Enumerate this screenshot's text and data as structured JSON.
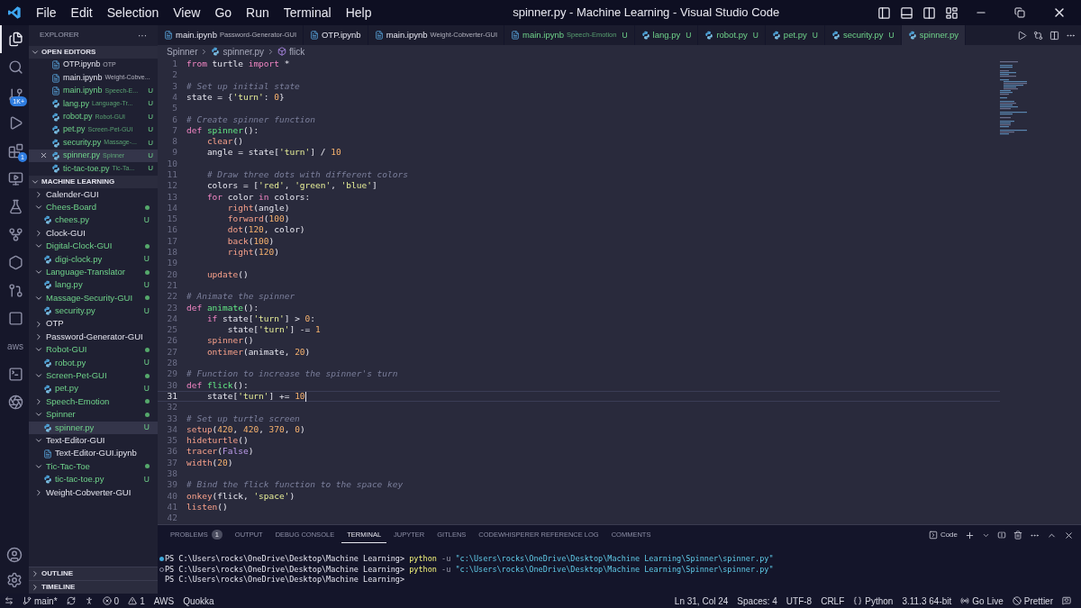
{
  "title_bar": {
    "menu": [
      "File",
      "Edit",
      "Selection",
      "View",
      "Go",
      "Run",
      "Terminal",
      "Help"
    ],
    "title": "spinner.py - Machine Learning - Visual Studio Code"
  },
  "activity_bar": {
    "items": [
      {
        "kind": "files",
        "selected": true
      },
      {
        "kind": "search",
        "selected": false
      },
      {
        "kind": "source-control",
        "selected": false,
        "badge": "1K+"
      },
      {
        "kind": "run",
        "selected": false
      },
      {
        "kind": "extensions",
        "selected": false,
        "badge": "1"
      },
      {
        "kind": "remote",
        "selected": false
      },
      {
        "kind": "testing",
        "selected": false
      },
      {
        "kind": "git-graph",
        "selected": false
      },
      {
        "kind": "hexagon",
        "selected": false
      },
      {
        "kind": "git-branch",
        "selected": false
      },
      {
        "kind": "square",
        "selected": false
      },
      {
        "kind": "aws",
        "selected": false,
        "label": "aws"
      },
      {
        "kind": "terminal",
        "selected": false
      },
      {
        "kind": "knot",
        "selected": false
      }
    ]
  },
  "sidebar": {
    "title": "EXPLORER",
    "more": "···",
    "open_editors": {
      "title": "OPEN EDITORS",
      "expanded": true,
      "items": [
        {
          "kind": "notebook",
          "name": "OTP.ipynb",
          "desc": "OTP",
          "untracked": false,
          "selected": false
        },
        {
          "kind": "notebook",
          "name": "main.ipynb",
          "desc": "Weight-Cobve...",
          "untracked": false,
          "selected": false
        },
        {
          "kind": "notebook",
          "name": "main.ipynb",
          "desc": "Speech-E...",
          "untracked": true,
          "badge": "U",
          "selected": false
        },
        {
          "kind": "python",
          "name": "lang.py",
          "desc": "Language-Tr...",
          "untracked": true,
          "badge": "U",
          "selected": false
        },
        {
          "kind": "python",
          "name": "robot.py",
          "desc": "Robot-GUI",
          "untracked": true,
          "badge": "U",
          "selected": false
        },
        {
          "kind": "python",
          "name": "pet.py",
          "desc": "Screen-Pet-GUI",
          "untracked": true,
          "badge": "U",
          "selected": false
        },
        {
          "kind": "python",
          "name": "security.py",
          "desc": "Massage-...",
          "untracked": true,
          "badge": "U",
          "selected": false
        },
        {
          "kind": "python",
          "name": "spinner.py",
          "desc": "Spinner",
          "untracked": true,
          "badge": "U",
          "selected": true
        },
        {
          "kind": "python",
          "name": "tic-tac-toe.py",
          "desc": "Tic-Ta...",
          "untracked": true,
          "badge": "U",
          "selected": false
        }
      ]
    },
    "folder": {
      "title": "MACHINE LEARNING",
      "expanded": true,
      "tree": [
        {
          "kind": "folder",
          "name": "Calender-GUI",
          "expanded": false,
          "untracked": false,
          "selected": false
        },
        {
          "kind": "folder",
          "name": "Chees-Board",
          "expanded": true,
          "untracked": true,
          "selected": false,
          "children": [
            {
              "kind": "python",
              "name": "chees.py",
              "untracked": true,
              "badge": "U",
              "selected": false
            }
          ]
        },
        {
          "kind": "folder",
          "name": "Clock-GUI",
          "expanded": false,
          "untracked": false,
          "selected": false
        },
        {
          "kind": "folder",
          "name": "Digital-Clock-GUI",
          "expanded": true,
          "untracked": true,
          "selected": false,
          "children": [
            {
              "kind": "python",
              "name": "digi-clock.py",
              "untracked": true,
              "badge": "U",
              "selected": false
            }
          ]
        },
        {
          "kind": "folder",
          "name": "Language-Translator",
          "expanded": true,
          "untracked": true,
          "selected": false,
          "children": [
            {
              "kind": "python",
              "name": "lang.py",
              "untracked": true,
              "badge": "U",
              "selected": false
            }
          ]
        },
        {
          "kind": "folder",
          "name": "Massage-Security-GUI",
          "expanded": true,
          "untracked": true,
          "selected": false,
          "children": [
            {
              "kind": "python",
              "name": "security.py",
              "untracked": true,
              "badge": "U",
              "selected": false
            }
          ]
        },
        {
          "kind": "folder",
          "name": "OTP",
          "expanded": false,
          "untracked": false,
          "selected": false
        },
        {
          "kind": "folder",
          "name": "Password-Generator-GUI",
          "expanded": false,
          "untracked": false,
          "selected": false
        },
        {
          "kind": "folder",
          "name": "Robot-GUI",
          "expanded": true,
          "untracked": true,
          "selected": false,
          "children": [
            {
              "kind": "python",
              "name": "robot.py",
              "untracked": true,
              "badge": "U",
              "selected": false
            }
          ]
        },
        {
          "kind": "folder",
          "name": "Screen-Pet-GUI",
          "expanded": true,
          "untracked": true,
          "selected": false,
          "children": [
            {
              "kind": "python",
              "name": "pet.py",
              "untracked": true,
              "badge": "U",
              "selected": false
            }
          ]
        },
        {
          "kind": "folder",
          "name": "Speech-Emotion",
          "expanded": false,
          "untracked": true,
          "selected": false
        },
        {
          "kind": "folder",
          "name": "Spinner",
          "expanded": true,
          "untracked": true,
          "selected": false,
          "children": [
            {
              "kind": "python",
              "name": "spinner.py",
              "untracked": true,
              "badge": "U",
              "selected": true
            }
          ]
        },
        {
          "kind": "folder",
          "name": "Text-Editor-GUI",
          "expanded": true,
          "untracked": false,
          "selected": false,
          "children": [
            {
              "kind": "notebook",
              "name": "Text-Editor-GUI.ipynb",
              "untracked": false,
              "selected": false
            }
          ]
        },
        {
          "kind": "folder",
          "name": "Tic-Tac-Toe",
          "expanded": true,
          "untracked": true,
          "selected": false,
          "children": [
            {
              "kind": "python",
              "name": "tic-tac-toe.py",
              "untracked": true,
              "badge": "U",
              "selected": false
            }
          ]
        },
        {
          "kind": "folder",
          "name": "Weight-Cobverter-GUI",
          "expanded": false,
          "untracked": false,
          "selected": false
        }
      ]
    },
    "sections": [
      {
        "title": "OUTLINE",
        "expanded": false
      },
      {
        "title": "TIMELINE",
        "expanded": false
      }
    ]
  },
  "editor_tabs": [
    {
      "kind": "notebook",
      "name": "main.ipynb",
      "desc": "Password-Generator-GUI",
      "untracked": false,
      "selected": false
    },
    {
      "kind": "notebook",
      "name": "OTP.ipynb",
      "untracked": false,
      "selected": false
    },
    {
      "kind": "notebook",
      "name": "main.ipynb",
      "desc": "Weight-Cobverter-GUI",
      "untracked": false,
      "selected": false
    },
    {
      "kind": "notebook",
      "name": "main.ipynb",
      "desc": "Speech-Emotion",
      "badge": "U",
      "untracked": true,
      "selected": false
    },
    {
      "kind": "python",
      "name": "lang.py",
      "badge": "U",
      "untracked": true,
      "selected": false
    },
    {
      "kind": "python",
      "name": "robot.py",
      "badge": "U",
      "untracked": true,
      "selected": false
    },
    {
      "kind": "python",
      "name": "pet.py",
      "badge": "U",
      "untracked": true,
      "selected": false
    },
    {
      "kind": "python",
      "name": "security.py",
      "badge": "U",
      "untracked": true,
      "selected": false
    },
    {
      "kind": "python",
      "name": "spinner.py",
      "untracked": true,
      "selected": true
    }
  ],
  "breadcrumb": [
    {
      "kind": "folder",
      "label": "Spinner"
    },
    {
      "kind": "python",
      "label": "spinner.py"
    },
    {
      "kind": "symbol",
      "label": "flick"
    }
  ],
  "editor": {
    "lines": [
      {
        "number": "1",
        "current": false,
        "tokens": [
          {
            "kind": "kw",
            "text": "from"
          },
          {
            "kind": "plain",
            "text": " turtle "
          },
          {
            "kind": "kw",
            "text": "import"
          },
          {
            "kind": "plain",
            "text": " *"
          }
        ]
      },
      {
        "number": "2",
        "current": false
      },
      {
        "number": "3",
        "current": false,
        "tokens": [
          {
            "kind": "cm",
            "text": "# Set up initial state"
          }
        ]
      },
      {
        "number": "4",
        "current": false,
        "tokens": [
          {
            "kind": "plain",
            "text": "state = {"
          },
          {
            "kind": "str",
            "text": "'turn'"
          },
          {
            "kind": "plain",
            "text": ": "
          },
          {
            "kind": "num",
            "text": "0"
          },
          {
            "kind": "plain",
            "text": "}"
          }
        ]
      },
      {
        "number": "5",
        "current": false
      },
      {
        "number": "6",
        "current": false,
        "tokens": [
          {
            "kind": "cm",
            "text": "# Create spinner function"
          }
        ]
      },
      {
        "number": "7",
        "current": false,
        "tokens": [
          {
            "kind": "kw",
            "text": "def"
          },
          {
            "kind": "fn",
            "text": " spinner"
          },
          {
            "kind": "plain",
            "text": "():"
          }
        ]
      },
      {
        "number": "8",
        "current": false,
        "tokens": [
          {
            "kind": "call",
            "text": "    clear"
          },
          {
            "kind": "plain",
            "text": "()"
          }
        ]
      },
      {
        "number": "9",
        "current": false,
        "tokens": [
          {
            "kind": "plain",
            "text": "    angle = state["
          },
          {
            "kind": "str",
            "text": "'turn'"
          },
          {
            "kind": "plain",
            "text": "] / "
          },
          {
            "kind": "num",
            "text": "10"
          }
        ]
      },
      {
        "number": "10",
        "current": false
      },
      {
        "number": "11",
        "current": false,
        "tokens": [
          {
            "kind": "cm",
            "text": "    # Draw three dots with different colors"
          }
        ]
      },
      {
        "number": "12",
        "current": false,
        "tokens": [
          {
            "kind": "plain",
            "text": "    colors = ["
          },
          {
            "kind": "str",
            "text": "'red'"
          },
          {
            "kind": "plain",
            "text": ", "
          },
          {
            "kind": "str",
            "text": "'green'"
          },
          {
            "kind": "plain",
            "text": ", "
          },
          {
            "kind": "str",
            "text": "'blue'"
          },
          {
            "kind": "plain",
            "text": "]"
          }
        ]
      },
      {
        "number": "13",
        "current": false,
        "tokens": [
          {
            "kind": "kw",
            "text": "    for"
          },
          {
            "kind": "plain",
            "text": " color "
          },
          {
            "kind": "kw",
            "text": "in"
          },
          {
            "kind": "plain",
            "text": " colors:"
          }
        ]
      },
      {
        "number": "14",
        "current": false,
        "tokens": [
          {
            "kind": "call",
            "text": "        right"
          },
          {
            "kind": "plain",
            "text": "(angle)"
          }
        ]
      },
      {
        "number": "15",
        "current": false,
        "tokens": [
          {
            "kind": "call",
            "text": "        forward"
          },
          {
            "kind": "plain",
            "text": "("
          },
          {
            "kind": "num",
            "text": "100"
          },
          {
            "kind": "plain",
            "text": ")"
          }
        ]
      },
      {
        "number": "16",
        "current": false,
        "tokens": [
          {
            "kind": "call",
            "text": "        dot"
          },
          {
            "kind": "plain",
            "text": "("
          },
          {
            "kind": "num",
            "text": "120"
          },
          {
            "kind": "plain",
            "text": ", color)"
          }
        ]
      },
      {
        "number": "17",
        "current": false,
        "tokens": [
          {
            "kind": "call",
            "text": "        back"
          },
          {
            "kind": "plain",
            "text": "("
          },
          {
            "kind": "num",
            "text": "100"
          },
          {
            "kind": "plain",
            "text": ")"
          }
        ]
      },
      {
        "number": "18",
        "current": false,
        "tokens": [
          {
            "kind": "call",
            "text": "        right"
          },
          {
            "kind": "plain",
            "text": "("
          },
          {
            "kind": "num",
            "text": "120"
          },
          {
            "kind": "plain",
            "text": ")"
          }
        ]
      },
      {
        "number": "19",
        "current": false
      },
      {
        "number": "20",
        "current": false,
        "tokens": [
          {
            "kind": "call",
            "text": "    update"
          },
          {
            "kind": "plain",
            "text": "()"
          }
        ]
      },
      {
        "number": "21",
        "current": false
      },
      {
        "number": "22",
        "current": false,
        "tokens": [
          {
            "kind": "cm",
            "text": "# Animate the spinner"
          }
        ]
      },
      {
        "number": "23",
        "current": false,
        "tokens": [
          {
            "kind": "kw",
            "text": "def"
          },
          {
            "kind": "fn",
            "text": " animate"
          },
          {
            "kind": "plain",
            "text": "():"
          }
        ]
      },
      {
        "number": "24",
        "current": false,
        "tokens": [
          {
            "kind": "kw",
            "text": "    if"
          },
          {
            "kind": "plain",
            "text": " state["
          },
          {
            "kind": "str",
            "text": "'turn'"
          },
          {
            "kind": "plain",
            "text": "] > "
          },
          {
            "kind": "num",
            "text": "0"
          },
          {
            "kind": "plain",
            "text": ":"
          }
        ]
      },
      {
        "number": "25",
        "current": false,
        "tokens": [
          {
            "kind": "plain",
            "text": "        state["
          },
          {
            "kind": "str",
            "text": "'turn'"
          },
          {
            "kind": "plain",
            "text": "] -= "
          },
          {
            "kind": "num",
            "text": "1"
          }
        ]
      },
      {
        "number": "26",
        "current": false,
        "tokens": [
          {
            "kind": "call",
            "text": "    spinner"
          },
          {
            "kind": "plain",
            "text": "()"
          }
        ]
      },
      {
        "number": "27",
        "current": false,
        "tokens": [
          {
            "kind": "call",
            "text": "    ontimer"
          },
          {
            "kind": "plain",
            "text": "(animate, "
          },
          {
            "kind": "num",
            "text": "20"
          },
          {
            "kind": "plain",
            "text": ")"
          }
        ]
      },
      {
        "number": "28",
        "current": false
      },
      {
        "number": "29",
        "current": false,
        "tokens": [
          {
            "kind": "cm",
            "text": "# Function to increase the spinner's turn"
          }
        ]
      },
      {
        "number": "30",
        "current": false,
        "tokens": [
          {
            "kind": "kw",
            "text": "def"
          },
          {
            "kind": "fn",
            "text": " flick"
          },
          {
            "kind": "plain",
            "text": "():"
          }
        ]
      },
      {
        "number": "31",
        "current": true,
        "tokens": [
          {
            "kind": "plain",
            "text": "    state["
          },
          {
            "kind": "str",
            "text": "'turn'"
          },
          {
            "kind": "plain",
            "text": "] += "
          },
          {
            "kind": "num",
            "text": "10"
          }
        ]
      },
      {
        "number": "32",
        "current": false
      },
      {
        "number": "33",
        "current": false,
        "tokens": [
          {
            "kind": "cm",
            "text": "# Set up turtle screen"
          }
        ]
      },
      {
        "number": "34",
        "current": false,
        "tokens": [
          {
            "kind": "call",
            "text": "setup"
          },
          {
            "kind": "plain",
            "text": "("
          },
          {
            "kind": "num",
            "text": "420"
          },
          {
            "kind": "plain",
            "text": ", "
          },
          {
            "kind": "num",
            "text": "420"
          },
          {
            "kind": "plain",
            "text": ", "
          },
          {
            "kind": "num",
            "text": "370"
          },
          {
            "kind": "plain",
            "text": ", "
          },
          {
            "kind": "num",
            "text": "0"
          },
          {
            "kind": "plain",
            "text": ")"
          }
        ]
      },
      {
        "number": "35",
        "current": false,
        "tokens": [
          {
            "kind": "call",
            "text": "hideturtle"
          },
          {
            "kind": "plain",
            "text": "()"
          }
        ]
      },
      {
        "number": "36",
        "current": false,
        "tokens": [
          {
            "kind": "call",
            "text": "tracer"
          },
          {
            "kind": "plain",
            "text": "("
          },
          {
            "kind": "const",
            "text": "False"
          },
          {
            "kind": "plain",
            "text": ")"
          }
        ]
      },
      {
        "number": "37",
        "current": false,
        "tokens": [
          {
            "kind": "call",
            "text": "width"
          },
          {
            "kind": "plain",
            "text": "("
          },
          {
            "kind": "num",
            "text": "20"
          },
          {
            "kind": "plain",
            "text": ")"
          }
        ]
      },
      {
        "number": "38",
        "current": false
      },
      {
        "number": "39",
        "current": false,
        "tokens": [
          {
            "kind": "cm",
            "text": "# Bind the flick function to the space key"
          }
        ]
      },
      {
        "number": "40",
        "current": false,
        "tokens": [
          {
            "kind": "call",
            "text": "onkey"
          },
          {
            "kind": "plain",
            "text": "(flick, "
          },
          {
            "kind": "str",
            "text": "'space'"
          },
          {
            "kind": "plain",
            "text": ")"
          }
        ]
      },
      {
        "number": "41",
        "current": false,
        "tokens": [
          {
            "kind": "call",
            "text": "listen"
          },
          {
            "kind": "plain",
            "text": "()"
          }
        ]
      },
      {
        "number": "42",
        "current": false
      }
    ]
  },
  "panel": {
    "tabs": [
      {
        "label": "PROBLEMS",
        "count": "1",
        "selected": false
      },
      {
        "label": "OUTPUT",
        "selected": false
      },
      {
        "label": "DEBUG CONSOLE",
        "selected": false
      },
      {
        "label": "TERMINAL",
        "selected": true
      },
      {
        "label": "JUPYTER",
        "selected": false
      },
      {
        "label": "GITLENS",
        "selected": false
      },
      {
        "label": "CODEWHISPERER REFERENCE LOG",
        "selected": false
      },
      {
        "label": "COMMENTS",
        "selected": false
      }
    ],
    "terminal_name": "Code",
    "terminal": [
      {
        "kind": "success",
        "tokens": [
          {
            "kind": "prompt",
            "text": "PS C:\\Users\\rocks\\OneDrive\\Desktop\\Machine Learning> "
          },
          {
            "kind": "cmd",
            "text": "python"
          },
          {
            "kind": "flag",
            "text": " -u "
          },
          {
            "kind": "path",
            "text": "\"c:\\Users\\rocks\\OneDrive\\Desktop\\Machine Learning\\Spinner\\spinner.py\""
          }
        ]
      },
      {
        "kind": "plain",
        "tokens": [
          {
            "kind": "prompt",
            "text": "PS C:\\Users\\rocks\\OneDrive\\Desktop\\Machine Learning> "
          },
          {
            "kind": "cmd",
            "text": "python"
          },
          {
            "kind": "flag",
            "text": " -u "
          },
          {
            "kind": "path",
            "text": "\"c:\\Users\\rocks\\OneDrive\\Desktop\\Machine Learning\\Spinner\\spinner.py\""
          }
        ]
      },
      {
        "kind": "none",
        "tokens": [
          {
            "kind": "prompt",
            "text": "PS C:\\Users\\rocks\\OneDrive\\Desktop\\Machine Learning>"
          }
        ]
      }
    ]
  },
  "status_bar": {
    "left": [
      {
        "kind": "remote"
      },
      {
        "kind": "branch",
        "text": "main*"
      },
      {
        "kind": "sync"
      },
      {
        "kind": "person"
      },
      {
        "kind": "error",
        "text": "0"
      },
      {
        "kind": "warning",
        "text": "1"
      },
      {
        "kind": "text",
        "text": "AWS"
      },
      {
        "kind": "text",
        "text": "Quokka"
      }
    ],
    "right": [
      {
        "kind": "text",
        "text": "Ln 31, Col 24"
      },
      {
        "kind": "text",
        "text": "Spaces: 4"
      },
      {
        "kind": "text",
        "text": "UTF-8"
      },
      {
        "kind": "text",
        "text": "CRLF"
      },
      {
        "kind": "braces",
        "text": "Python"
      },
      {
        "kind": "text",
        "text": "3.11.3 64-bit"
      },
      {
        "kind": "radio",
        "text": "Go Live"
      },
      {
        "kind": "ban",
        "text": "Prettier"
      },
      {
        "kind": "feedback"
      }
    ]
  }
}
